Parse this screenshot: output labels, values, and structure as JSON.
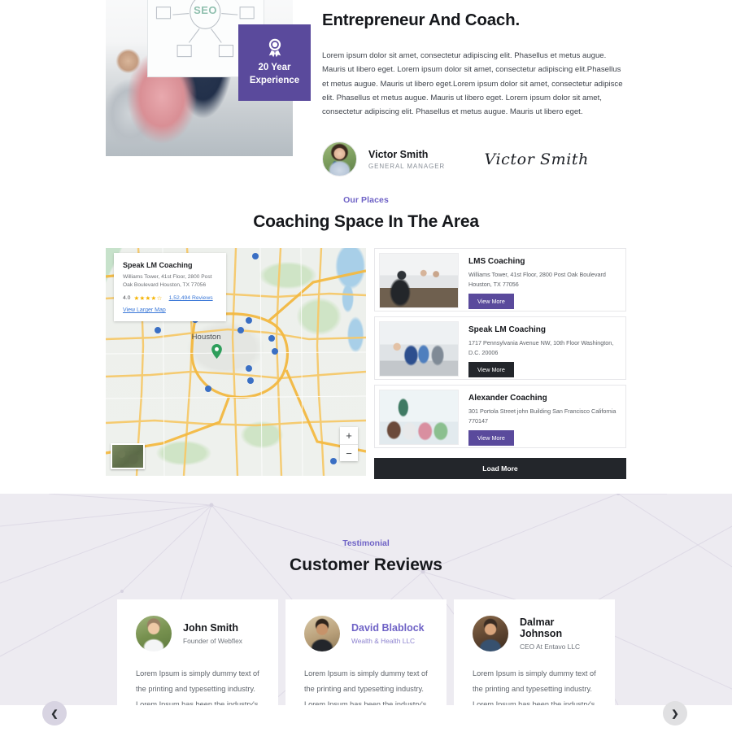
{
  "about": {
    "title": "Entrepreneur And Coach.",
    "paragraph": "Lorem ipsum dolor sit amet, consectetur adipiscing elit. Phasellus et metus augue. Mauris ut libero eget. Lorem ipsum dolor sit amet, consectetur adipiscing elit.Phasellus et metus augue. Mauris ut libero eget.Lorem ipsum dolor sit amet, consectetur adipisce elit. Phasellus et metus augue. Mauris ut libero eget. Lorem ipsum dolor sit amet, consectetur adipiscing elit. Phasellus et metus augue. Mauris ut libero eget.",
    "badge": {
      "icon": "award-ribbon-icon",
      "line1": "20 Year",
      "line2": "Experience",
      "color": "#5a4a9c"
    },
    "author": {
      "name": "Victor Smith",
      "role": "GENERAL MANAGER",
      "signature": "Victor Smith",
      "avatar_icon": "author-avatar"
    }
  },
  "places": {
    "eyebrow": "Our Places",
    "title": "Coaching Space In The Area",
    "accent_color": "#6f63c6",
    "map": {
      "info_card": {
        "title": "Speak LM Coaching",
        "address": "Williams Tower, 41st Floor, 2800 Post Oak Boulevard Houston, TX 77056",
        "rating": "4.0",
        "stars_filled": 4,
        "stars_total": 5,
        "reviews": "1,52,494 Reviews",
        "larger_map_link": "View Larger Map"
      },
      "city_label": "Houston",
      "zoom_in": "+",
      "zoom_out": "−"
    },
    "cards": [
      {
        "name": "LMS Coaching",
        "address": "Williams Tower, 41st Floor, 2800 Post Oak Boulevard Houston, TX 77056",
        "button": "View More",
        "button_style": "purple"
      },
      {
        "name": "Speak LM Coaching",
        "address": "1717 Pennsylvania Avenue NW, 10th Floor Washington, D.C. 20006",
        "button": "View More",
        "button_style": "dark"
      },
      {
        "name": "Alexander Coaching",
        "address": "301 Portola Street john Building San Francisco California 770147",
        "button": "View More",
        "button_style": "purple"
      }
    ],
    "load_more": "Load More"
  },
  "testimonial": {
    "eyebrow": "Testimonial",
    "title": "Customer Reviews",
    "body": "Lorem Ipsum is simply dummy text of the printing and typesetting industry. Lorem Ipsum has been the industry's standard dummy text ever since the",
    "prev_icon": "chevron-left-icon",
    "next_icon": "chevron-right-icon",
    "reviews": [
      {
        "name": "John Smith",
        "role": "Founder of Webflex",
        "highlight": false
      },
      {
        "name": "David Blablock",
        "role": "Wealth & Health LLC",
        "highlight": true
      },
      {
        "name": "Dalmar Johnson",
        "role": "CEO At Entavo LLC",
        "highlight": false
      }
    ]
  }
}
